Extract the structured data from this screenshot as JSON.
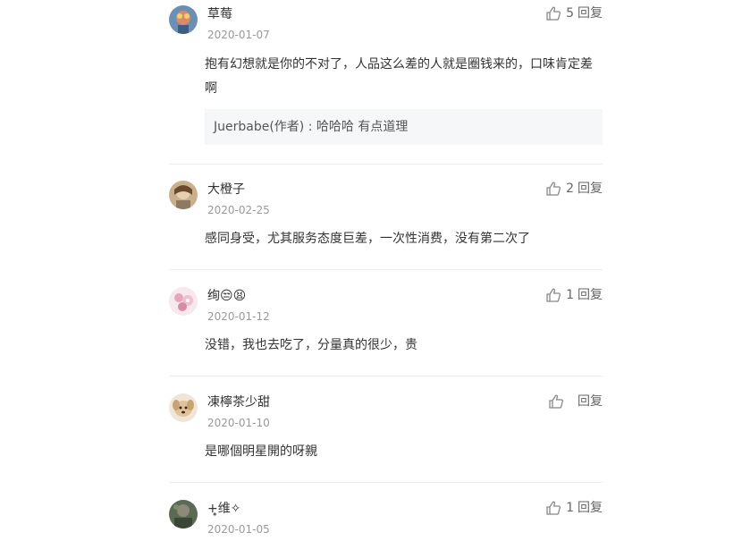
{
  "comments": [
    {
      "name": "草莓",
      "date": "2020-01-07",
      "likes": "5",
      "reply_label": "回复",
      "text": "抱有幻想就是你的不对了，人品这么差的人就是圈钱来的，口味肯定差啊",
      "author_reply": "Juerbabe(作者) : 哈哈哈 有点道理"
    },
    {
      "name": "大橙子",
      "date": "2020-02-25",
      "likes": "2",
      "reply_label": "回复",
      "text": "感同身受，尤其服务态度巨差，一次性消费，没有第二次了"
    },
    {
      "name": "绚😒😫",
      "date": "2020-01-12",
      "likes": "1",
      "reply_label": "回复",
      "text": "没错，我也去吃了，分量真的很少，贵"
    },
    {
      "name": "凍檸茶少甜",
      "date": "2020-01-10",
      "likes": "",
      "reply_label": "回复",
      "text": "是哪個明星開的呀親"
    },
    {
      "name": "+̥̥维✧",
      "date": "2020-01-05",
      "likes": "1",
      "reply_label": "回复",
      "text": ""
    }
  ],
  "icons": {
    "like": "thumbs-up-icon",
    "avatar_colors": [
      "#5a7fa6",
      "#c7a37a",
      "#e9b7c6",
      "#d9c3a0",
      "#4d5a4a"
    ]
  }
}
